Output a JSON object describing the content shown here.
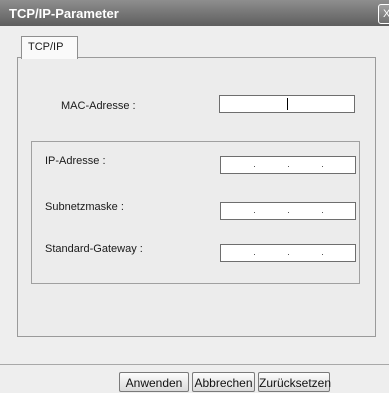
{
  "window": {
    "title": "TCP/IP-Parameter",
    "close_glyph": "X"
  },
  "tabs": [
    {
      "label": "TCP/IP"
    }
  ],
  "mac": {
    "label": "MAC-Adresse :",
    "value": ""
  },
  "ip_group": {
    "ip_label": "IP-Adresse :",
    "subnet_label": "Subnetzmaske :",
    "gateway_label": "Standard-Gateway :"
  },
  "buttons": {
    "apply": "Anwenden",
    "cancel": "Abbrechen",
    "reset": "Zurücksetzen"
  }
}
